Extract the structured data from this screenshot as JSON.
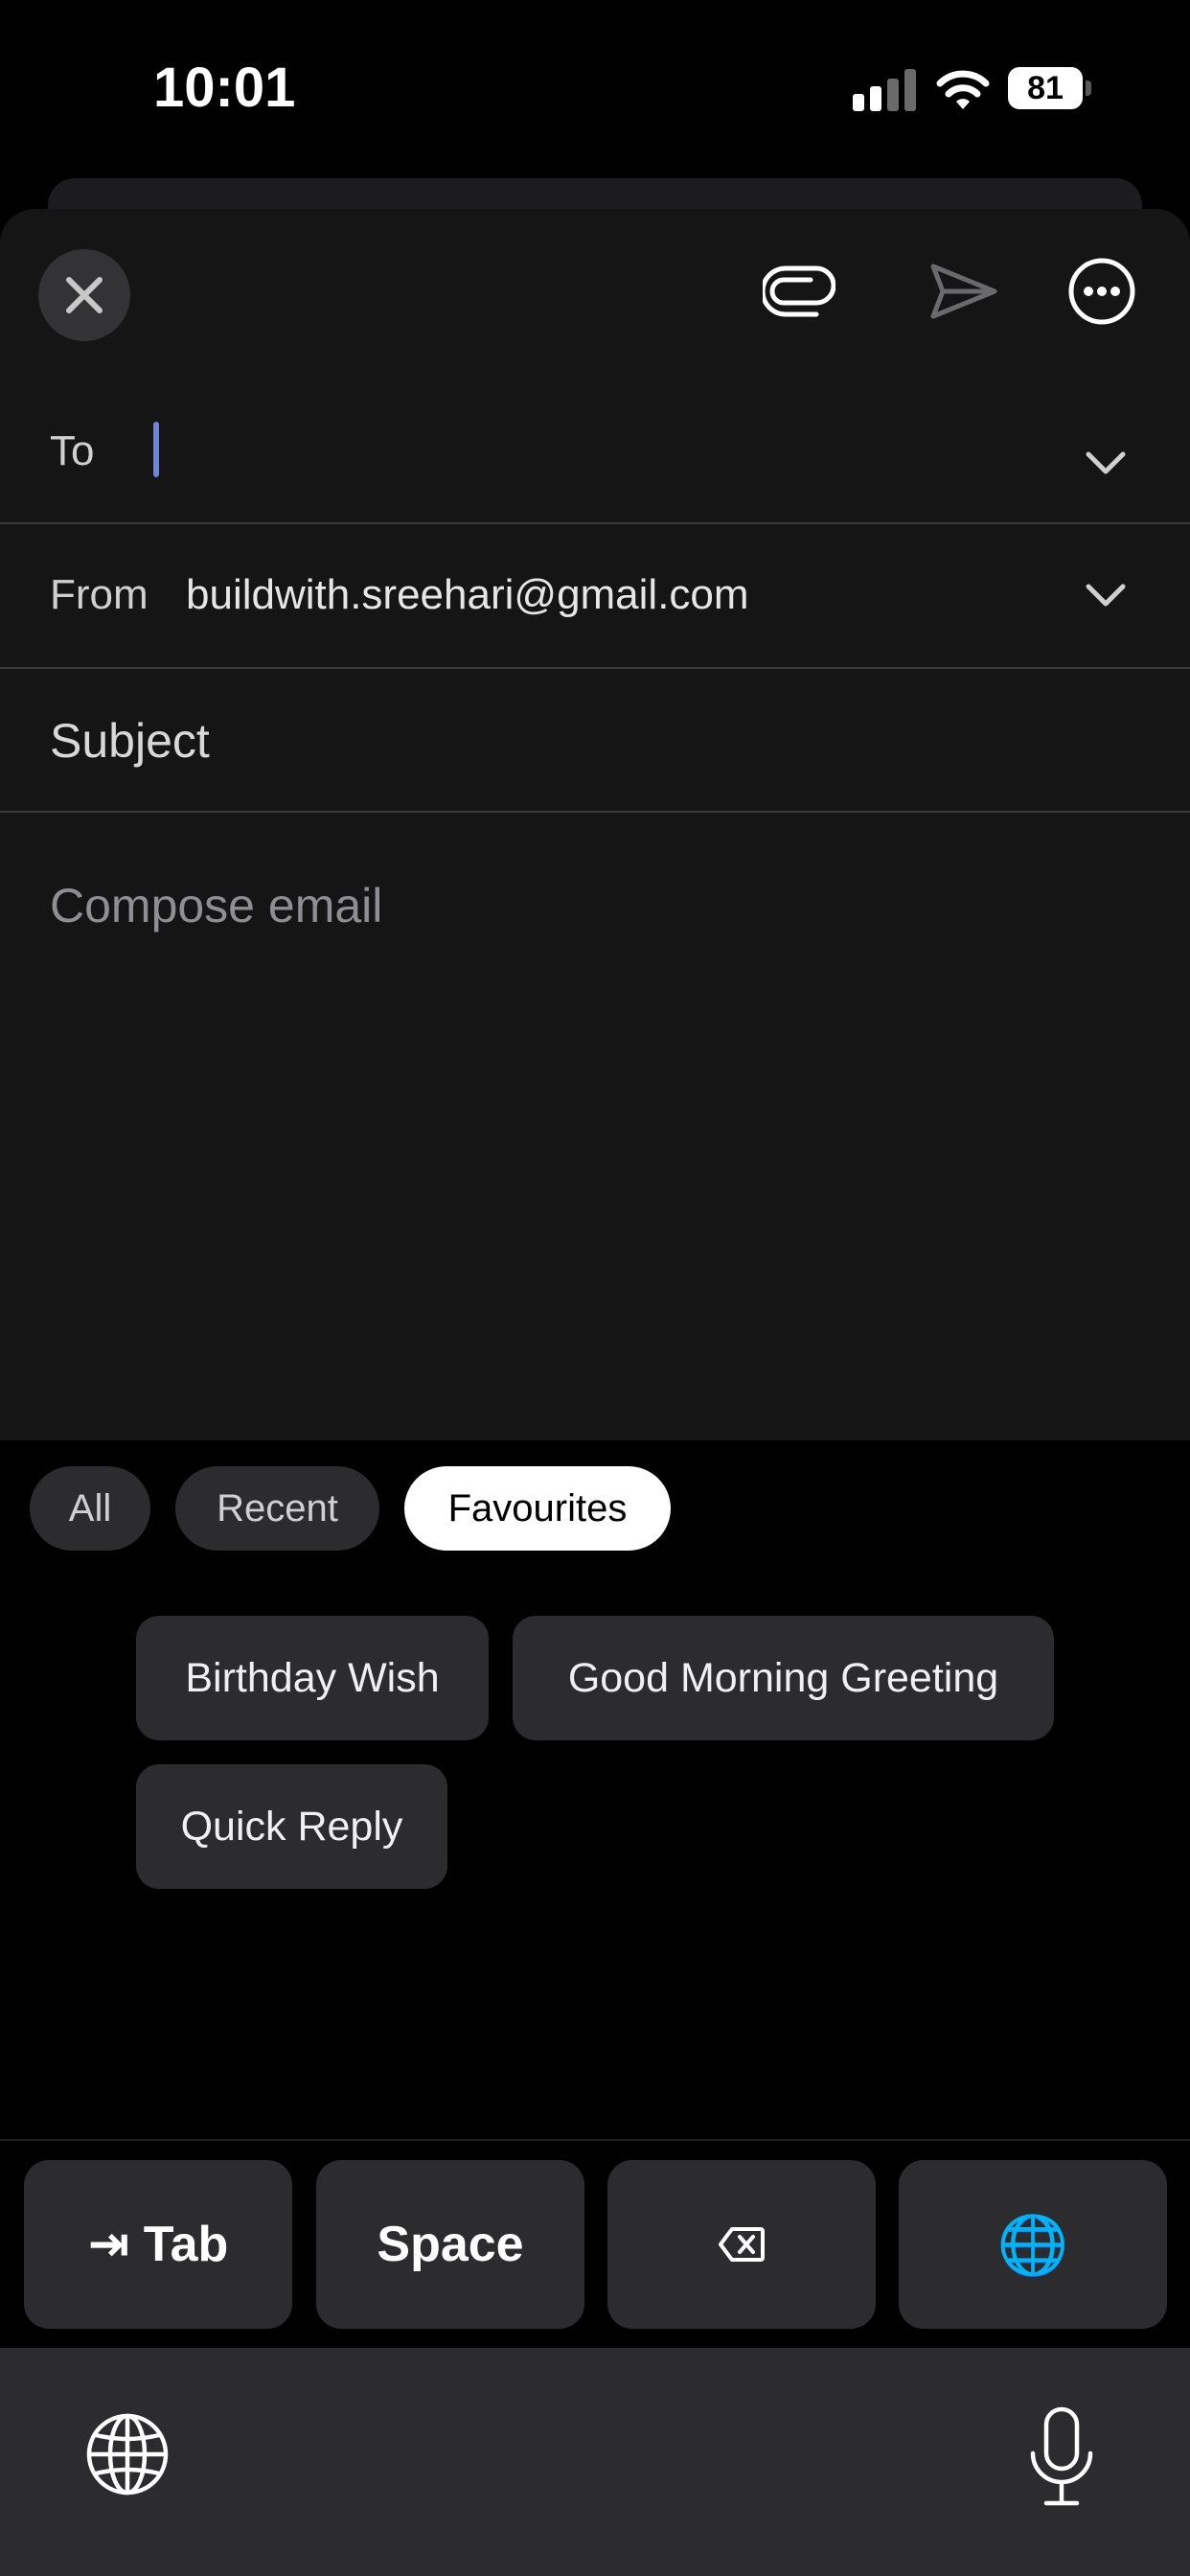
{
  "status_bar": {
    "time": "10:01",
    "battery": "81"
  },
  "toolbar": {
    "close_icon": "close-icon",
    "attach_icon": "paperclip-icon",
    "send_icon": "send-icon",
    "more_icon": "more-icon"
  },
  "compose": {
    "to_label": "To",
    "to_value": "",
    "from_label": "From",
    "from_value": "buildwith.sreehari@gmail.com",
    "subject_placeholder": "Subject",
    "body_placeholder": "Compose email"
  },
  "filters": {
    "items": [
      "All",
      "Recent",
      "Favourites"
    ],
    "selected": "Favourites"
  },
  "templates": [
    "Birthday Wish",
    "Good Morning Greeting",
    "Quick Reply"
  ],
  "keys": {
    "tab": "⇥ Tab",
    "space": "Space",
    "delete_icon": "delete-backward-icon",
    "globe": "🌐"
  },
  "colors": {
    "background": "#000000",
    "sheet": "#151516",
    "pill": "#2c2c2e",
    "pill_active": "#ffffff",
    "cursor": "#6e86d8"
  }
}
